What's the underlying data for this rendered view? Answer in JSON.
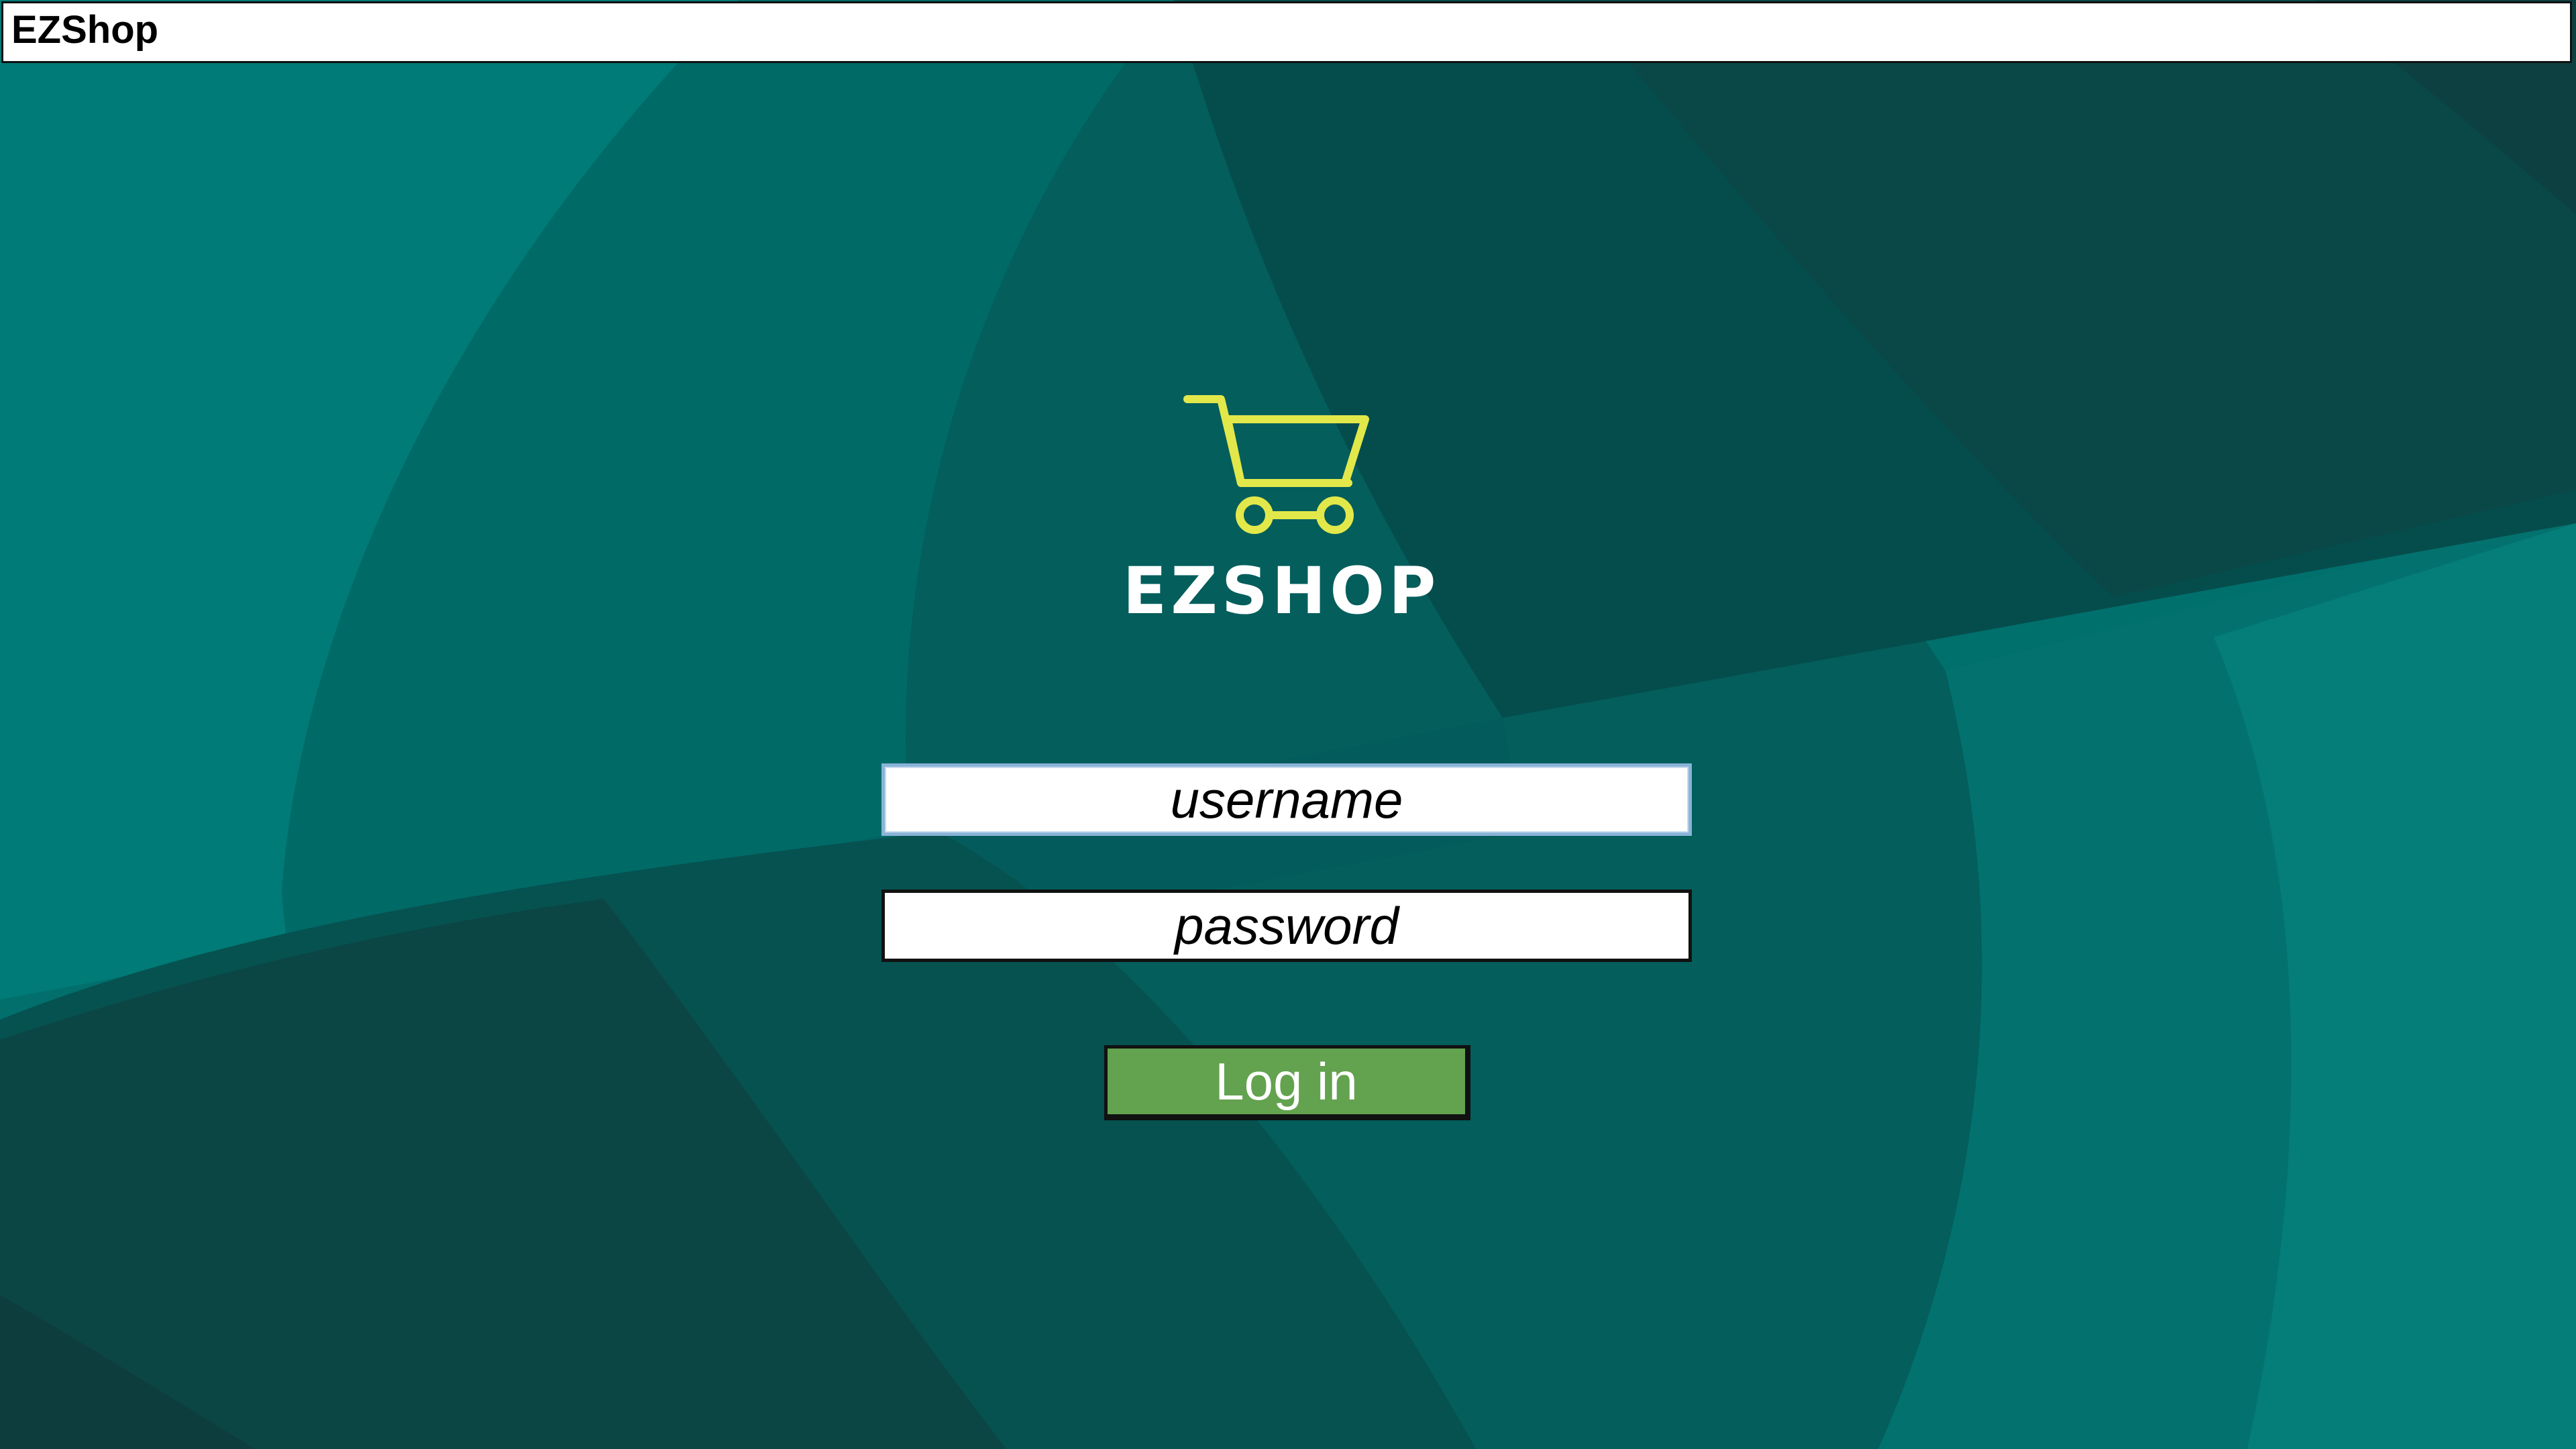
{
  "window": {
    "title": "EZShop"
  },
  "logo": {
    "text": "EZSHOP",
    "icon": "shopping-cart-icon",
    "cart_color": "#e2e84a",
    "text_color": "#ffffff"
  },
  "form": {
    "username": {
      "placeholder": "username",
      "value": ""
    },
    "password": {
      "placeholder": "password",
      "value": ""
    },
    "login_label": "Log in"
  },
  "colors": {
    "background": "#006b68",
    "button": "#63a24f",
    "username_border": "#8ab4d8"
  }
}
